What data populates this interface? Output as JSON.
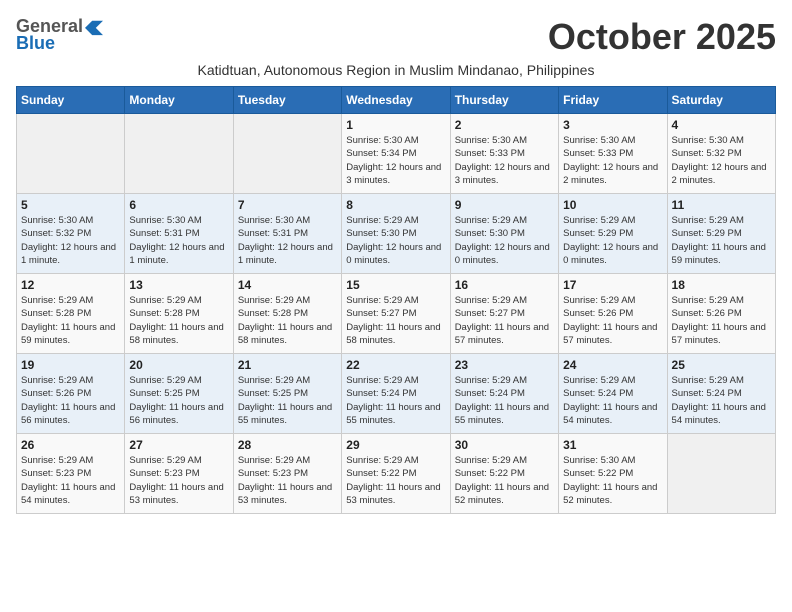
{
  "header": {
    "logo_general": "General",
    "logo_blue": "Blue",
    "month_title": "October 2025",
    "subtitle": "Katidtuan, Autonomous Region in Muslim Mindanao, Philippines"
  },
  "days_of_week": [
    "Sunday",
    "Monday",
    "Tuesday",
    "Wednesday",
    "Thursday",
    "Friday",
    "Saturday"
  ],
  "weeks": [
    [
      {
        "day": "",
        "info": ""
      },
      {
        "day": "",
        "info": ""
      },
      {
        "day": "",
        "info": ""
      },
      {
        "day": "1",
        "info": "Sunrise: 5:30 AM\nSunset: 5:34 PM\nDaylight: 12 hours and 3 minutes."
      },
      {
        "day": "2",
        "info": "Sunrise: 5:30 AM\nSunset: 5:33 PM\nDaylight: 12 hours and 3 minutes."
      },
      {
        "day": "3",
        "info": "Sunrise: 5:30 AM\nSunset: 5:33 PM\nDaylight: 12 hours and 2 minutes."
      },
      {
        "day": "4",
        "info": "Sunrise: 5:30 AM\nSunset: 5:32 PM\nDaylight: 12 hours and 2 minutes."
      }
    ],
    [
      {
        "day": "5",
        "info": "Sunrise: 5:30 AM\nSunset: 5:32 PM\nDaylight: 12 hours and 1 minute."
      },
      {
        "day": "6",
        "info": "Sunrise: 5:30 AM\nSunset: 5:31 PM\nDaylight: 12 hours and 1 minute."
      },
      {
        "day": "7",
        "info": "Sunrise: 5:30 AM\nSunset: 5:31 PM\nDaylight: 12 hours and 1 minute."
      },
      {
        "day": "8",
        "info": "Sunrise: 5:29 AM\nSunset: 5:30 PM\nDaylight: 12 hours and 0 minutes."
      },
      {
        "day": "9",
        "info": "Sunrise: 5:29 AM\nSunset: 5:30 PM\nDaylight: 12 hours and 0 minutes."
      },
      {
        "day": "10",
        "info": "Sunrise: 5:29 AM\nSunset: 5:29 PM\nDaylight: 12 hours and 0 minutes."
      },
      {
        "day": "11",
        "info": "Sunrise: 5:29 AM\nSunset: 5:29 PM\nDaylight: 11 hours and 59 minutes."
      }
    ],
    [
      {
        "day": "12",
        "info": "Sunrise: 5:29 AM\nSunset: 5:28 PM\nDaylight: 11 hours and 59 minutes."
      },
      {
        "day": "13",
        "info": "Sunrise: 5:29 AM\nSunset: 5:28 PM\nDaylight: 11 hours and 58 minutes."
      },
      {
        "day": "14",
        "info": "Sunrise: 5:29 AM\nSunset: 5:28 PM\nDaylight: 11 hours and 58 minutes."
      },
      {
        "day": "15",
        "info": "Sunrise: 5:29 AM\nSunset: 5:27 PM\nDaylight: 11 hours and 58 minutes."
      },
      {
        "day": "16",
        "info": "Sunrise: 5:29 AM\nSunset: 5:27 PM\nDaylight: 11 hours and 57 minutes."
      },
      {
        "day": "17",
        "info": "Sunrise: 5:29 AM\nSunset: 5:26 PM\nDaylight: 11 hours and 57 minutes."
      },
      {
        "day": "18",
        "info": "Sunrise: 5:29 AM\nSunset: 5:26 PM\nDaylight: 11 hours and 57 minutes."
      }
    ],
    [
      {
        "day": "19",
        "info": "Sunrise: 5:29 AM\nSunset: 5:26 PM\nDaylight: 11 hours and 56 minutes."
      },
      {
        "day": "20",
        "info": "Sunrise: 5:29 AM\nSunset: 5:25 PM\nDaylight: 11 hours and 56 minutes."
      },
      {
        "day": "21",
        "info": "Sunrise: 5:29 AM\nSunset: 5:25 PM\nDaylight: 11 hours and 55 minutes."
      },
      {
        "day": "22",
        "info": "Sunrise: 5:29 AM\nSunset: 5:24 PM\nDaylight: 11 hours and 55 minutes."
      },
      {
        "day": "23",
        "info": "Sunrise: 5:29 AM\nSunset: 5:24 PM\nDaylight: 11 hours and 55 minutes."
      },
      {
        "day": "24",
        "info": "Sunrise: 5:29 AM\nSunset: 5:24 PM\nDaylight: 11 hours and 54 minutes."
      },
      {
        "day": "25",
        "info": "Sunrise: 5:29 AM\nSunset: 5:24 PM\nDaylight: 11 hours and 54 minutes."
      }
    ],
    [
      {
        "day": "26",
        "info": "Sunrise: 5:29 AM\nSunset: 5:23 PM\nDaylight: 11 hours and 54 minutes."
      },
      {
        "day": "27",
        "info": "Sunrise: 5:29 AM\nSunset: 5:23 PM\nDaylight: 11 hours and 53 minutes."
      },
      {
        "day": "28",
        "info": "Sunrise: 5:29 AM\nSunset: 5:23 PM\nDaylight: 11 hours and 53 minutes."
      },
      {
        "day": "29",
        "info": "Sunrise: 5:29 AM\nSunset: 5:22 PM\nDaylight: 11 hours and 53 minutes."
      },
      {
        "day": "30",
        "info": "Sunrise: 5:29 AM\nSunset: 5:22 PM\nDaylight: 11 hours and 52 minutes."
      },
      {
        "day": "31",
        "info": "Sunrise: 5:30 AM\nSunset: 5:22 PM\nDaylight: 11 hours and 52 minutes."
      },
      {
        "day": "",
        "info": ""
      }
    ]
  ]
}
